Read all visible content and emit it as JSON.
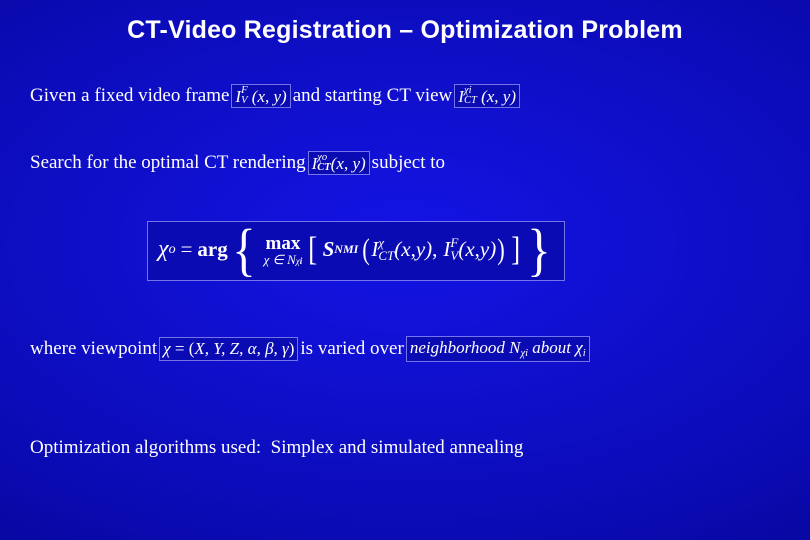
{
  "slide": {
    "title": "CT-Video Registration – Optimization Problem",
    "background_color": "#0000c8",
    "text_color": "#ffffff"
  },
  "line1": {
    "part1": "Given a fixed video frame",
    "equation1": "I_V^F (x, y)",
    "part2": "and starting CT view",
    "equation2": "I_CT^{χi} (x, y)"
  },
  "line2": {
    "part1": "Search for the optimal CT rendering",
    "equation1": "I_CT^{χo}(x, y)",
    "part2": "subject to"
  },
  "main_equation": {
    "latex": "χ_o = arg { max_{χ ∈ N_{χi}} [ S_NMI ( I_CT^χ(x,y), I_V^F(x,y) ) ] }",
    "lhs": "χo",
    "arg": "arg",
    "max_top": "max",
    "max_bottom": "χ ∈ Nχi",
    "similarity": "S",
    "similarity_sub": "NMI",
    "arg1": "Iᴄᴛ^χ(x, y)",
    "arg2": "Iᴠ^F(x, y)"
  },
  "line4": {
    "part1": "where viewpoint",
    "equation1": "χ = (X, Y, Z, α, β, γ)",
    "part2": "is varied over",
    "equation2": "neighborhood Nχi about χi"
  },
  "line5": {
    "text": "Optimization algorithms used:  Simplex and simulated annealing"
  }
}
